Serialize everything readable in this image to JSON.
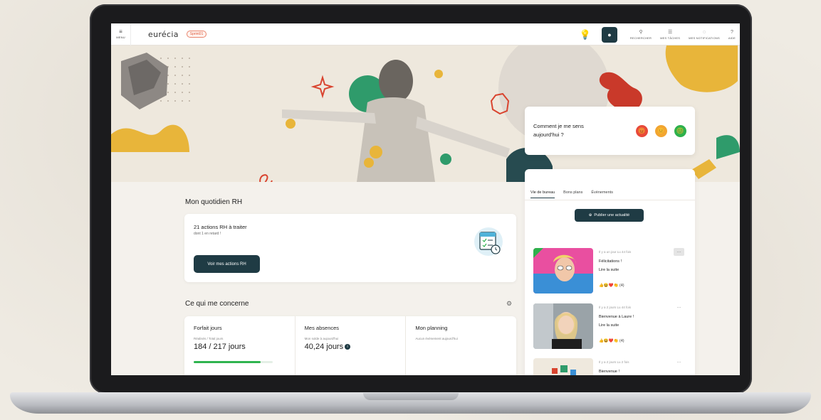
{
  "topbar": {
    "menu_icon": "≡",
    "menu_label": "MENU",
    "logo": "eurécia",
    "badge": "Sprint01",
    "bulb_icon": "💡",
    "dark_icon": "●",
    "items": [
      {
        "icon": "⚲",
        "label": "RECHERCHER"
      },
      {
        "icon": "☰",
        "label": "MES TÂCHES"
      },
      {
        "icon": "◌",
        "label": "MES NOTIFICATIONS"
      },
      {
        "icon": "?",
        "label": "AIDE"
      }
    ]
  },
  "mood": {
    "question": "Comment je me sens aujourd'hui ?",
    "faces": [
      "😠",
      "😐",
      "😊"
    ],
    "colors": [
      "#e8493a",
      "#f2a531",
      "#2db14c"
    ]
  },
  "rh": {
    "title": "Mon quotidien RH",
    "actions_title": "21 actions RH à traiter",
    "actions_sub": "dont 1 en retard !",
    "button": "Voir mes actions RH"
  },
  "concern": {
    "title": "Ce qui me concerne",
    "icon": "⚙",
    "cols": [
      {
        "head": "Forfait jours",
        "sub": "Réalisés / Total jours",
        "value": "184 / 217 jours"
      },
      {
        "head": "Mes absences",
        "sub": "Mon solde à aujourd'hui",
        "value": "40,24 jours",
        "info": "i"
      },
      {
        "head": "Mon planning",
        "sub": "Aucun évènement aujourd'hui",
        "value": ""
      }
    ],
    "progress": 0.85
  },
  "feed": {
    "tabs": [
      "Vie de bureau",
      "Bons plans",
      "Évènements"
    ],
    "publish": "Publier une actualité",
    "posts": [
      {
        "meta": "Il y a un jour Lu 44 fois",
        "title": "Félicitations !",
        "more": "Lire la suite",
        "reactions": "👍😆❤️👏 (4)",
        "dots": "···"
      },
      {
        "meta": "Il y a 2 jours Lu 44 fois",
        "title": "Bienvenue à Laure !",
        "more": "Lire la suite",
        "reactions": "👍😆❤️👏 (4)",
        "dots": "···"
      },
      {
        "meta": "Il y a 2 jours Lu 2 fois",
        "title": "Bienvenue !",
        "more": "",
        "reactions": "",
        "dots": "···"
      }
    ]
  }
}
